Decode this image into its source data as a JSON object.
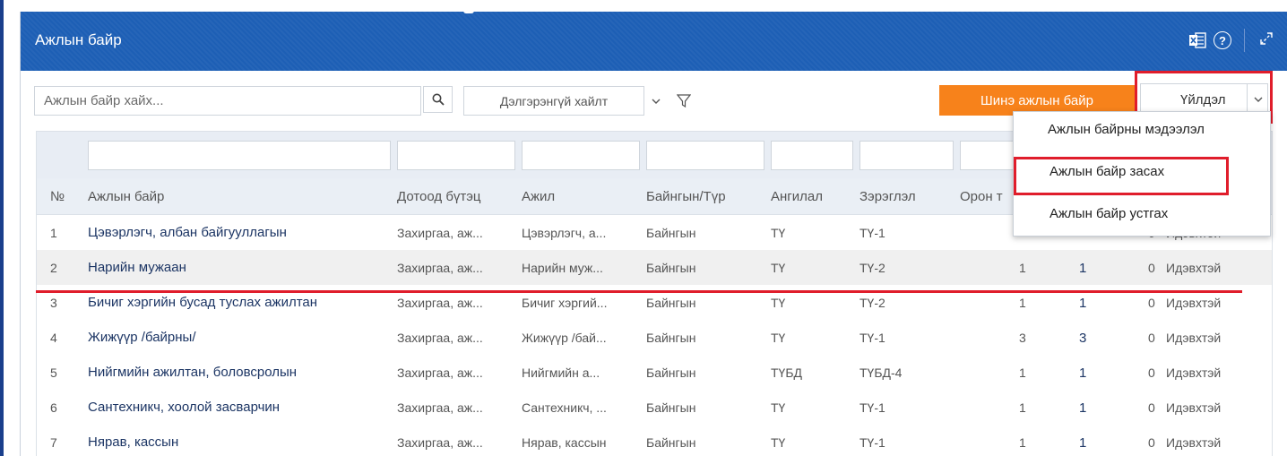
{
  "window": {
    "title": "Ажлын байр"
  },
  "toolbar": {
    "search_placeholder": "Ажлын байр хайх...",
    "advanced_search_label": "Дэлгэрэнгүй хайлт",
    "new_job_label": "Шинэ ажлын байр",
    "action_label": "Үйлдэл"
  },
  "action_menu": {
    "items": [
      "Ажлын байрны мэдээлэл",
      "Ажлын байр засах",
      "Ажлын байр устгах"
    ]
  },
  "table": {
    "columns": [
      "№",
      "Ажлын байр",
      "Дотоод бүтэц",
      "Ажил",
      "Байнгын/Түр",
      "Ангилал",
      "Зэрэглэл",
      "Орон т"
    ],
    "rows": [
      [
        "1",
        "Цэвэрлэгч, албан байгууллагын",
        "Захиргаа, аж...",
        "Цэвэрлэгч, а...",
        "Байнгын",
        "ТҮ",
        "ТҮ-1",
        "",
        "",
        "0",
        "Идэвхтэй"
      ],
      [
        "2",
        "Нарийн мужаан",
        "Захиргаа, аж...",
        "Нарийн муж...",
        "Байнгын",
        "ТҮ",
        "ТҮ-2",
        "1",
        "1",
        "0",
        "Идэвхтэй"
      ],
      [
        "3",
        "Бичиг хэргийн бусад туслах ажилтан",
        "Захиргаа, аж...",
        "Бичиг хэргий...",
        "Байнгын",
        "ТҮ",
        "ТҮ-2",
        "1",
        "1",
        "0",
        "Идэвхтэй"
      ],
      [
        "4",
        "Жижүүр /байрны/",
        "Захиргаа, аж...",
        "Жижүүр /бай...",
        "Байнгын",
        "ТҮ",
        "ТҮ-1",
        "3",
        "3",
        "0",
        "Идэвхтэй"
      ],
      [
        "5",
        "Нийгмийн ажилтан, боловсролын",
        "Захиргаа, аж...",
        "Нийгмийн а...",
        "Байнгын",
        "ТҮБД",
        "ТҮБД-4",
        "1",
        "1",
        "0",
        "Идэвхтэй"
      ],
      [
        "6",
        "Сантехникч, хоолой засварчин",
        "Захиргаа, аж...",
        "Сантехникч, ...",
        "Байнгын",
        "ТҮ",
        "ТҮ-1",
        "1",
        "1",
        "0",
        "Идэвхтэй"
      ],
      [
        "7",
        "Нярав, кассын",
        "Захиргаа, аж...",
        "Нярав, кассын",
        "Байнгын",
        "ТҮ",
        "ТҮ-1",
        "1",
        "1",
        "0",
        "Идэвхтэй"
      ]
    ]
  },
  "colors": {
    "header": "#1d5fb5",
    "primary_action": "#f7821b",
    "highlight": "#e01d2b"
  }
}
